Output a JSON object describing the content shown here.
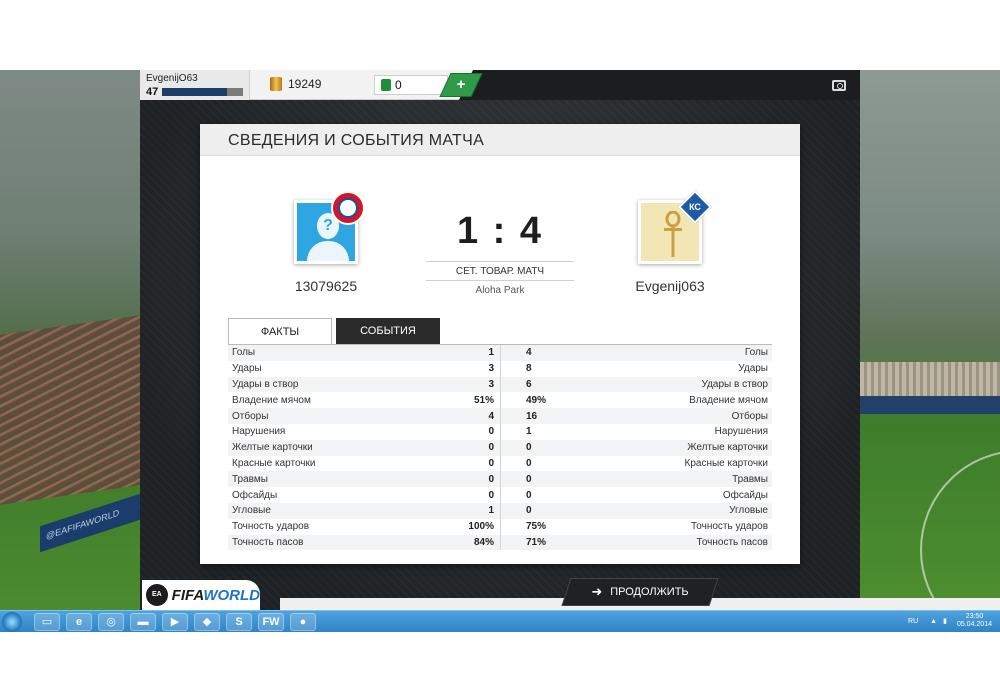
{
  "user": {
    "name": "EvgenijO63",
    "level": "47",
    "level_progress": 0.8
  },
  "currency": {
    "coins": "19249",
    "points": "0",
    "add_label": "+"
  },
  "card": {
    "title": "СВЕДЕНИЯ И СОБЫТИЯ МАТЧА",
    "home": {
      "name": "13079625",
      "club_badge": "bayern-badge"
    },
    "away": {
      "name": "Evgenij063",
      "club_badge": "krylia-badge",
      "club_badge_text": "КС"
    },
    "score": "1 : 4",
    "match_type": "СЕТ. ТОВАР. МАТЧ",
    "stadium": "Aloha Park",
    "tabs": {
      "facts": "ФАКТЫ",
      "events": "СОБЫТИЯ"
    }
  },
  "stats": [
    {
      "label": "Голы",
      "home": "1",
      "away": "4"
    },
    {
      "label": "Удары",
      "home": "3",
      "away": "8"
    },
    {
      "label": "Удары в створ",
      "home": "3",
      "away": "6"
    },
    {
      "label": "Владение мячом",
      "home": "51%",
      "away": "49%"
    },
    {
      "label": "Отборы",
      "home": "4",
      "away": "16"
    },
    {
      "label": "Нарушения",
      "home": "0",
      "away": "1"
    },
    {
      "label": "Желтые карточки",
      "home": "0",
      "away": "0"
    },
    {
      "label": "Красные карточки",
      "home": "0",
      "away": "0"
    },
    {
      "label": "Травмы",
      "home": "0",
      "away": "0"
    },
    {
      "label": "Офсайды",
      "home": "0",
      "away": "0"
    },
    {
      "label": "Угловые",
      "home": "1",
      "away": "0"
    },
    {
      "label": "Точность ударов",
      "home": "100%",
      "away": "75%"
    },
    {
      "label": "Точность пасов",
      "home": "84%",
      "away": "71%"
    }
  ],
  "continue_label": "ПРОДОЛЖИТЬ",
  "logo": {
    "ea": "EA",
    "fifa": "FIFA",
    "world": "WORLD"
  },
  "background": {
    "banner_text": "@EAFIFAWORLD"
  },
  "taskbar": {
    "lang": "RU",
    "time": "23:50",
    "date": "05.04.2014",
    "apps": [
      "windows-explorer-icon",
      "ie-icon",
      "chrome-icon",
      "media-icon",
      "player-icon",
      "game-icon",
      "skype-icon",
      "fifa-world-icon",
      "origin-icon"
    ]
  },
  "colors": {
    "accent_green": "#2f9a47",
    "level_blue": "#1b3f67",
    "header_bg": "#eeeeee"
  }
}
